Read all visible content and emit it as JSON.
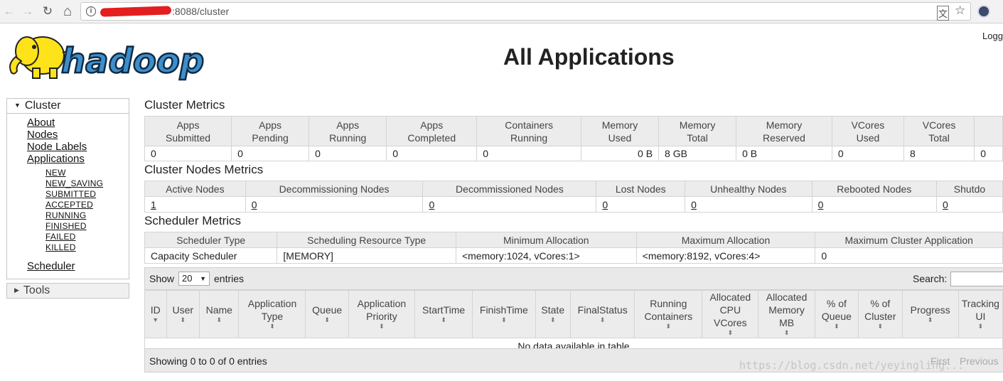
{
  "browser": {
    "back_icon": "←",
    "forward_icon": "→",
    "reload_icon": "↻",
    "home_icon": "⌂",
    "info_icon": "i",
    "url": ":8088/cluster",
    "translate_icon": "文",
    "star_icon": "☆"
  },
  "header": {
    "logo_text": "hadoop",
    "title": "All Applications",
    "logged_in": "Logg"
  },
  "sidebar": {
    "cluster_label": "Cluster",
    "links": [
      "About",
      "Nodes",
      "Node Labels",
      "Applications"
    ],
    "app_states": [
      "NEW",
      "NEW_SAVING",
      "SUBMITTED",
      "ACCEPTED",
      "RUNNING",
      "FINISHED",
      "FAILED",
      "KILLED"
    ],
    "scheduler_label": "Scheduler",
    "tools_label": "Tools"
  },
  "cluster_metrics": {
    "title": "Cluster Metrics",
    "headers": [
      [
        "Apps",
        "Submitted"
      ],
      [
        "Apps",
        "Pending"
      ],
      [
        "Apps",
        "Running"
      ],
      [
        "Apps",
        "Completed"
      ],
      [
        "Containers",
        "Running"
      ],
      [
        "Memory",
        "Used"
      ],
      [
        "Memory",
        "Total"
      ],
      [
        "Memory",
        "Reserved"
      ],
      [
        "VCores",
        "Used"
      ],
      [
        "VCores",
        "Total"
      ],
      [
        "",
        ""
      ]
    ],
    "values": [
      "0",
      "0",
      "0",
      "0",
      "0",
      "0 B",
      "8 GB",
      "0 B",
      "0",
      "8",
      "0"
    ]
  },
  "nodes_metrics": {
    "title": "Cluster Nodes Metrics",
    "headers": [
      "Active Nodes",
      "Decommissioning Nodes",
      "Decommissioned Nodes",
      "Lost Nodes",
      "Unhealthy Nodes",
      "Rebooted Nodes",
      "Shutdo"
    ],
    "values": [
      "1",
      "0",
      "0",
      "0",
      "0",
      "0",
      "0"
    ]
  },
  "scheduler_metrics": {
    "title": "Scheduler Metrics",
    "headers": [
      "Scheduler Type",
      "Scheduling Resource Type",
      "Minimum Allocation",
      "Maximum Allocation",
      "Maximum Cluster Application"
    ],
    "values": [
      "Capacity Scheduler",
      "[MEMORY]",
      "<memory:1024, vCores:1>",
      "<memory:8192, vCores:4>",
      "0"
    ]
  },
  "apps_table": {
    "show_label": "Show",
    "entries_label": "entries",
    "page_size": "20",
    "search_label": "Search:",
    "columns": [
      [
        "ID"
      ],
      [
        "User"
      ],
      [
        "Name"
      ],
      [
        "Application",
        "Type"
      ],
      [
        "Queue"
      ],
      [
        "Application",
        "Priority"
      ],
      [
        "StartTime"
      ],
      [
        "FinishTime"
      ],
      [
        "State"
      ],
      [
        "FinalStatus"
      ],
      [
        "Running",
        "Containers"
      ],
      [
        "Allocated",
        "CPU",
        "VCores"
      ],
      [
        "Allocated",
        "Memory",
        "MB"
      ],
      [
        "% of",
        "Queue"
      ],
      [
        "% of",
        "Cluster"
      ],
      [
        "Progress"
      ],
      [
        "Tracking",
        "UI"
      ]
    ],
    "empty_message": "No data available in table",
    "info": "Showing 0 to 0 of 0 entries",
    "first_label": "First",
    "previous_label": "Previous"
  },
  "watermark": "https://blog.csdn.net/yeyingling..."
}
